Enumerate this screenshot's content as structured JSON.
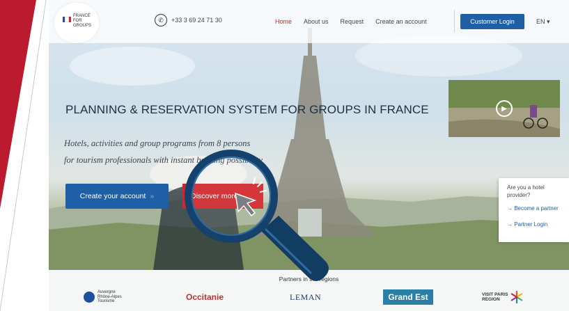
{
  "logo": {
    "text_lines": [
      "FRANCE",
      "FOR",
      "GROUPS"
    ],
    "flag_colors": [
      "#1f4ea1",
      "#ffffff",
      "#d0262b"
    ]
  },
  "header": {
    "phone_icon": "phone-icon",
    "phone": "+33 3 69 24 71 30",
    "nav": [
      {
        "label": "Home",
        "active": true
      },
      {
        "label": "About us",
        "active": false
      },
      {
        "label": "Request",
        "active": false
      },
      {
        "label": "Create an account",
        "active": false
      }
    ],
    "login_label": "Customer Login",
    "lang_label": "EN ▾"
  },
  "hero": {
    "title": "PLANNING & RESERVATION SYSTEM FOR GROUPS IN FRANCE",
    "subtitle_line1": "Hotels, activities and group programs from 8 persons",
    "subtitle_line2": "for tourism professionals with instant booking possibility",
    "create_label": "Create your account",
    "create_chevron": "»",
    "discover_label": "Discover more"
  },
  "video": {
    "play_icon": "play-icon"
  },
  "provider": {
    "question": "Are you a hotel provider?",
    "become_partner": "→ Become a partner",
    "partner_login": "→ Partner Login"
  },
  "partners": {
    "title": "Partners in the regions",
    "logos": [
      {
        "line1": "Auvergne",
        "line2": "Rhône-Alpes",
        "line3": "Tourisme"
      },
      {
        "name": "Occitanie"
      },
      {
        "name": "LEMAN"
      },
      {
        "name": "Grand Est"
      },
      {
        "line1": "VISIT PARIS",
        "line2": "REGION"
      }
    ]
  },
  "colors": {
    "brand_blue": "#1e5fa6",
    "brand_red": "#d0262b",
    "active_nav": "#c62a2f"
  }
}
